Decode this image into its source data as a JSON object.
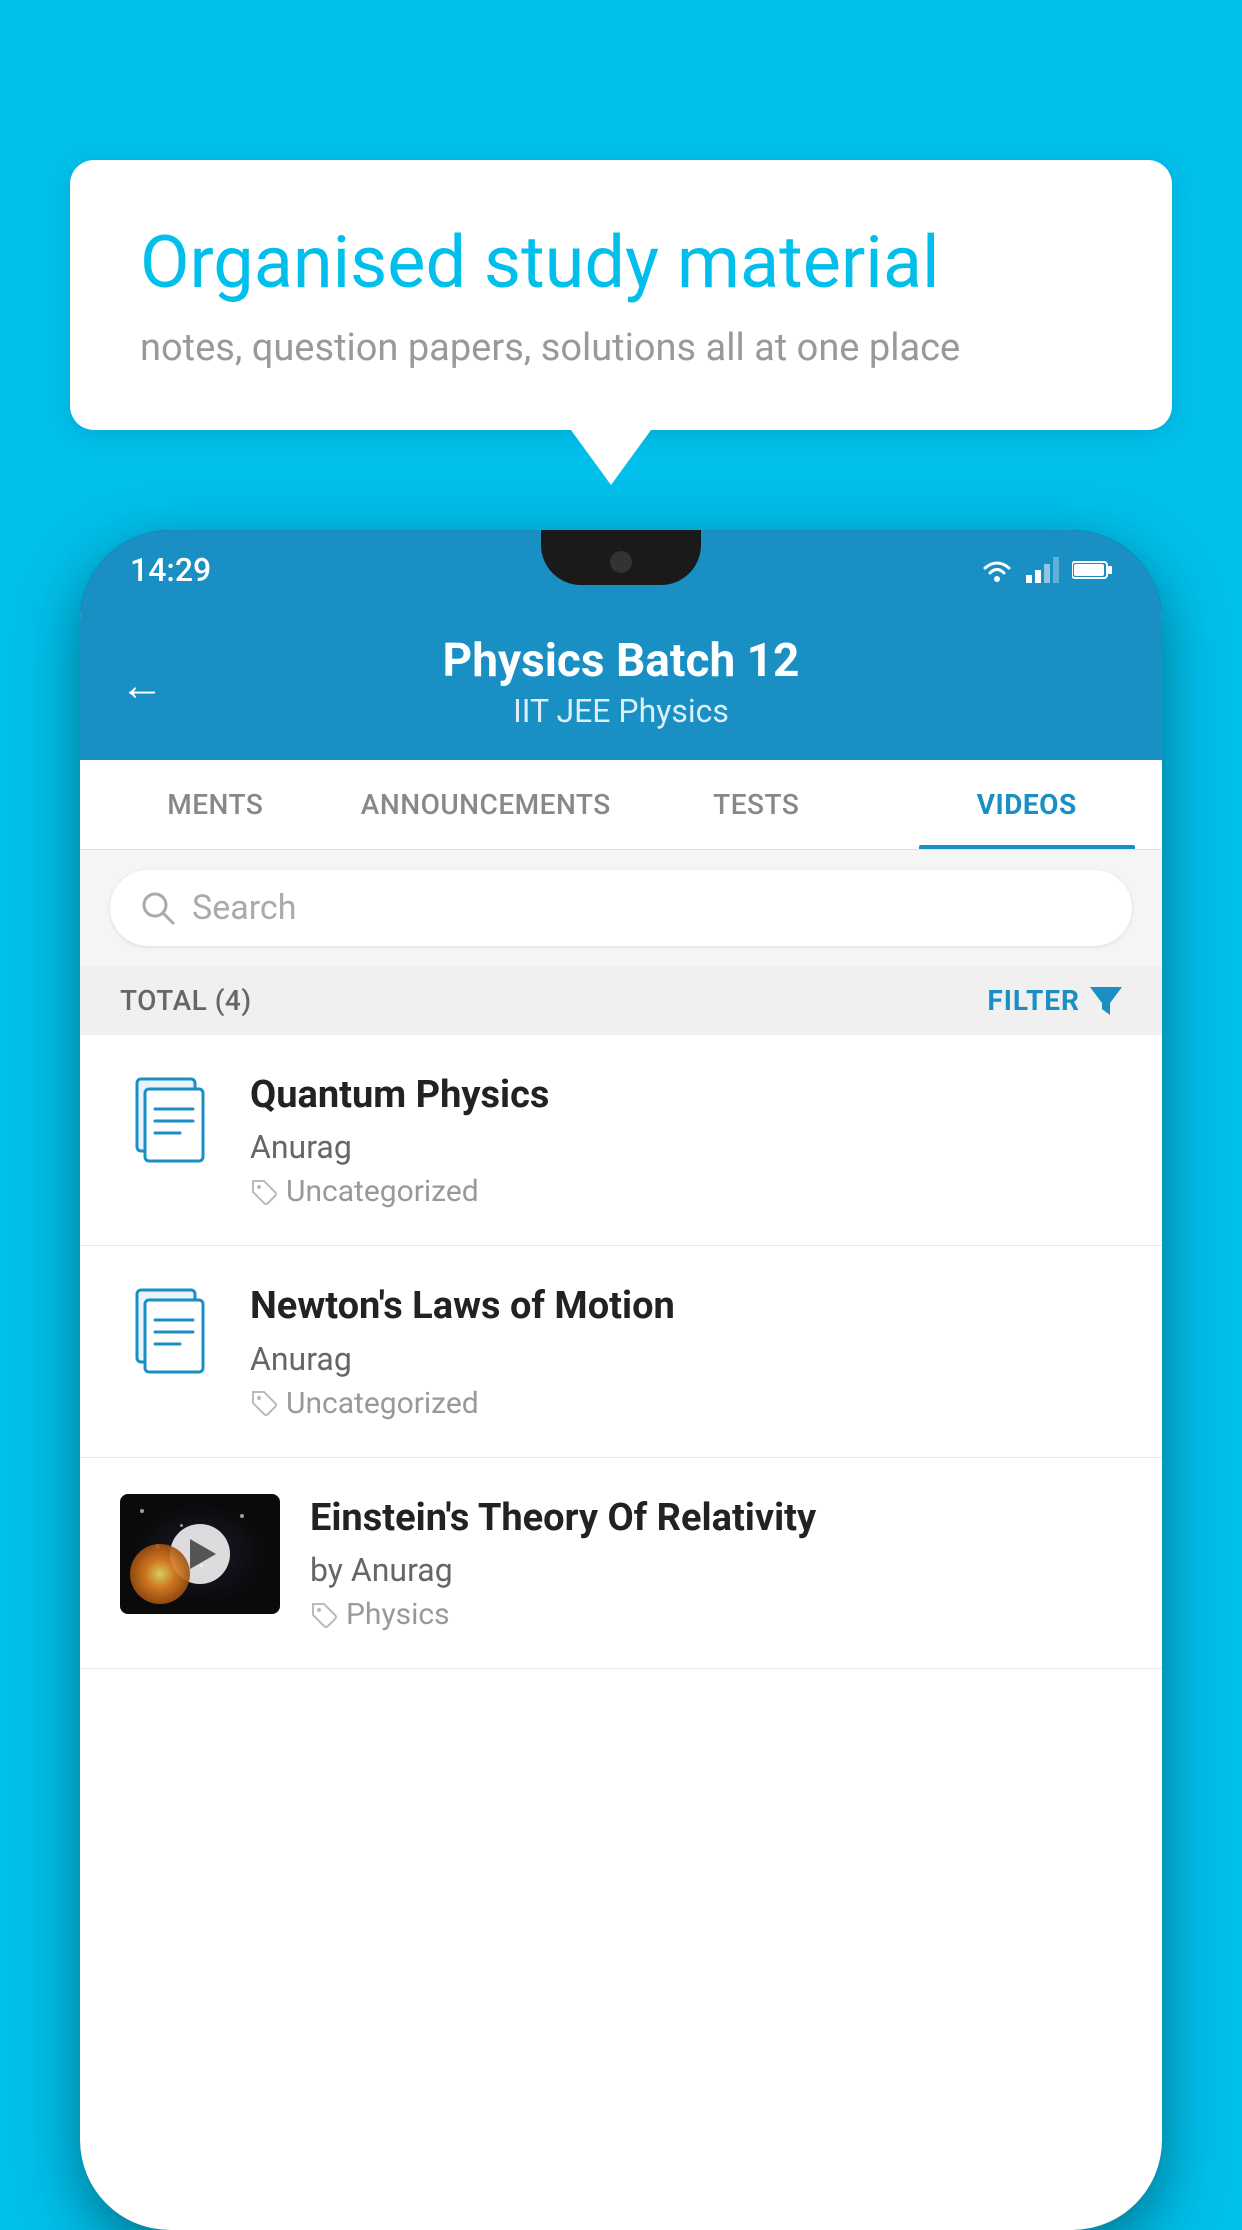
{
  "app": {
    "background_color": "#00BFEA"
  },
  "speech_bubble": {
    "title": "Organised study material",
    "subtitle": "notes, question papers, solutions all at one place"
  },
  "phone": {
    "status_bar": {
      "time": "14:29"
    },
    "header": {
      "title": "Physics Batch 12",
      "subtitle": "IIT JEE    Physics",
      "back_label": "←"
    },
    "tabs": [
      {
        "label": "MENTS",
        "active": false
      },
      {
        "label": "ANNOUNCEMENTS",
        "active": false
      },
      {
        "label": "TESTS",
        "active": false
      },
      {
        "label": "VIDEOS",
        "active": true
      }
    ],
    "search": {
      "placeholder": "Search"
    },
    "filter_bar": {
      "total_label": "TOTAL (4)",
      "filter_label": "FILTER"
    },
    "videos": [
      {
        "id": 1,
        "title": "Quantum Physics",
        "author": "Anurag",
        "tag": "Uncategorized",
        "has_thumbnail": false
      },
      {
        "id": 2,
        "title": "Newton's Laws of Motion",
        "author": "Anurag",
        "tag": "Uncategorized",
        "has_thumbnail": false
      },
      {
        "id": 3,
        "title": "Einstein's Theory Of Relativity",
        "author": "by Anurag",
        "tag": "Physics",
        "has_thumbnail": true
      }
    ]
  }
}
